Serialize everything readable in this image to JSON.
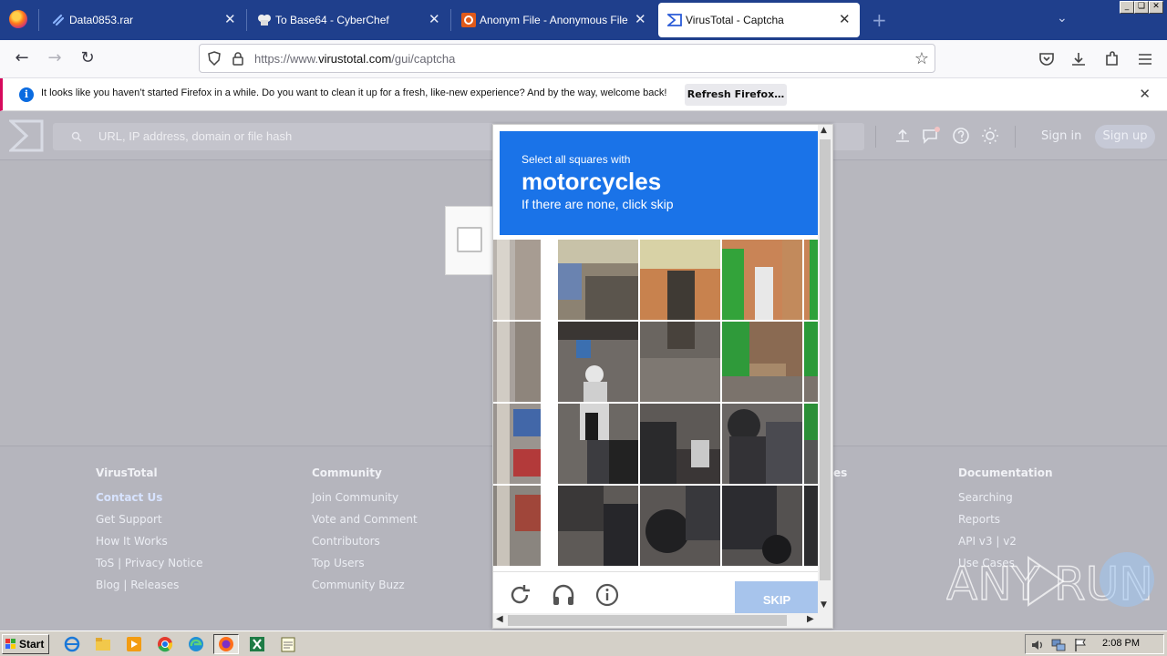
{
  "browser": {
    "tabs": [
      {
        "label": "Data0853.rar",
        "icon": "link-icon",
        "active": false
      },
      {
        "label": "To Base64 - CyberChef",
        "icon": "chef-hat-icon",
        "active": false
      },
      {
        "label": "Anonym File - Anonymous File Uplo",
        "icon": "anonym-file-icon",
        "active": false
      },
      {
        "label": "VirusTotal - Captcha",
        "icon": "virustotal-icon",
        "active": true
      }
    ],
    "close_glyph": "✕",
    "new_tab_glyph": "+",
    "url_prefix": "https://www.",
    "url_domain": "virustotal.com",
    "url_path": "/gui/captcha"
  },
  "notification": {
    "text": "It looks like you haven’t started Firefox in a while. Do you want to clean it up for a fresh, like-new experience? And by the way, welcome back!",
    "button": "Refresh Firefox…"
  },
  "virustotal": {
    "search_placeholder": "URL, IP address, domain or file hash",
    "sign_in": "Sign in",
    "sign_up": "Sign up",
    "footer": [
      {
        "heading": "VirusTotal",
        "links": [
          "Contact Us",
          "Get Support",
          "How It Works",
          "ToS | Privacy Notice",
          "Blog | Releases"
        ]
      },
      {
        "heading": "Community",
        "links": [
          "Join Community",
          "Vote and Comment",
          "Contributors",
          "Top Users",
          "Community Buzz"
        ]
      },
      {
        "heading": "Documentation",
        "links": [
          "Searching",
          "Reports",
          "API v3 | v2",
          "Use Cases"
        ]
      }
    ],
    "partial_heading_fragment": "es"
  },
  "captcha": {
    "instruction": "Select all squares with",
    "target": "motorcycles",
    "hint": "If there are none, click skip",
    "skip": "SKIP",
    "rows": 4,
    "cols": 4
  },
  "watermark": "ANY RUN",
  "taskbar": {
    "start": "Start",
    "clock": "2:08 PM"
  },
  "colors": {
    "captcha_blue": "#1a73e8",
    "skip_disabled": "#a7c4ec",
    "tabstrip": "#1f3f8c",
    "notification_accent": "#d60a5c"
  }
}
